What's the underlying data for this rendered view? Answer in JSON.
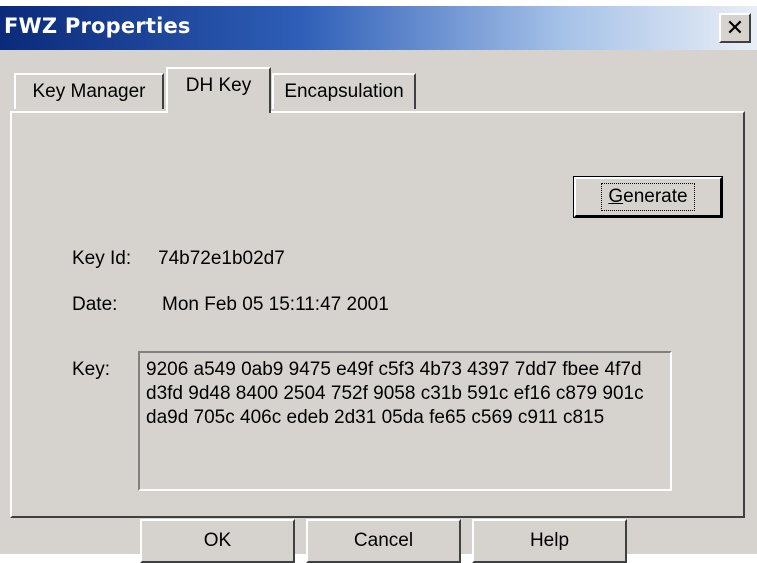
{
  "window": {
    "title": "FWZ Properties",
    "close_glyph": "✕"
  },
  "tabs": [
    {
      "label": "Key Manager",
      "active": false
    },
    {
      "label": "DH Key",
      "active": true
    },
    {
      "label": "Encapsulation",
      "active": false
    }
  ],
  "dh_key": {
    "generate_prefix": "G",
    "generate_rest": "enerate",
    "key_id_label": "Key Id:",
    "key_id_value": "74b72e1b02d7",
    "date_label": "Date:",
    "date_value": "Mon Feb 05 15:11:47 2001",
    "key_label": "Key:",
    "key_value": "9206 a549 0ab9 9475 e49f c5f3 4b73 4397 7dd7 fbee 4f7d d3fd 9d48 8400 2504 752f 9058 c31b 591c ef16 c879 901c da9d 705c 406c edeb 2d31 05da fe65 c569 c911 c815"
  },
  "buttons": {
    "ok": "OK",
    "cancel": "Cancel",
    "help": "Help"
  },
  "colors": {
    "face": "#d6d3ce",
    "title_start": "#0b2a7a",
    "title_end": "#e9eef6"
  }
}
